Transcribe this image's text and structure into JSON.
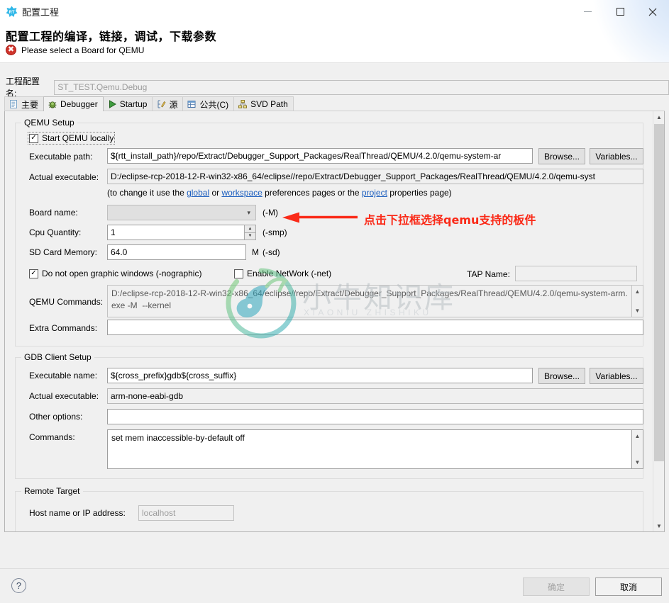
{
  "window": {
    "title": "配置工程",
    "app_icon": "rt-thread-icon",
    "minimize": "minimize-icon",
    "maximize": "maximize-icon",
    "close": "close-icon"
  },
  "header": {
    "title": "配置工程的编译，链接，调试，下载参数",
    "status_icon": "error-icon",
    "status_message": "Please select a Board for QEMU",
    "error_color": "#d0342c"
  },
  "config_name": {
    "label": "工程配置名:",
    "value": "ST_TEST.Qemu.Debug"
  },
  "tabs": [
    {
      "label": "主要",
      "icon": "document-icon",
      "active": false
    },
    {
      "label": "Debugger",
      "icon": "bug-icon",
      "active": true
    },
    {
      "label": "Startup",
      "icon": "play-icon",
      "active": false
    },
    {
      "label": "源",
      "icon": "source-icon",
      "active": false
    },
    {
      "label": "公共(C)",
      "icon": "table-icon",
      "active": false
    },
    {
      "label": "SVD Path",
      "icon": "tree-icon",
      "active": false
    }
  ],
  "qemu_setup": {
    "group_title": "QEMU Setup",
    "start_locally": {
      "label": "Start QEMU locally",
      "checked": true
    },
    "executable_path": {
      "label": "Executable path:",
      "value": "${rtt_install_path}/repo/Extract/Debugger_Support_Packages/RealThread/QEMU/4.2.0/qemu-system-ar",
      "browse": "Browse...",
      "variables": "Variables..."
    },
    "actual_executable": {
      "label": "Actual executable:",
      "value": "D:/eclipse-rcp-2018-12-R-win32-x86_64/eclipse//repo/Extract/Debugger_Support_Packages/RealThread/QEMU/4.2.0/qemu-syst"
    },
    "hint": {
      "prefix": "(to change it use the ",
      "link1": "global",
      "mid1": " or ",
      "link2": "workspace",
      "mid2": " preferences pages or the ",
      "link3": "project",
      "suffix": " properties page)"
    },
    "board_name": {
      "label": "Board name:",
      "value": "",
      "suffix": "(-M)"
    },
    "cpu_quantity": {
      "label": "Cpu Quantity:",
      "value": "1",
      "suffix": "(-smp)"
    },
    "sd_card_memory": {
      "label": "SD Card Memory:",
      "value": "64.0",
      "unit": "M",
      "suffix": "(-sd)"
    },
    "nographic": {
      "label": "Do not open graphic windows (-nographic)",
      "checked": true
    },
    "enable_network": {
      "label": "Enable NetWork (-net)",
      "checked": false
    },
    "tap_name": {
      "label": "TAP Name:",
      "value": ""
    },
    "qemu_commands": {
      "label": "QEMU Commands:",
      "value": "D:/eclipse-rcp-2018-12-R-win32-x86_64/eclipse//repo/Extract/Debugger_Support_Packages/RealThread/QEMU/4.2.0/qemu-system-arm.exe -M  --kernel"
    },
    "extra_commands": {
      "label": "Extra Commands:",
      "value": ""
    }
  },
  "gdb_client_setup": {
    "group_title": "GDB Client Setup",
    "executable_name": {
      "label": "Executable name:",
      "value": "${cross_prefix}gdb${cross_suffix}",
      "browse": "Browse...",
      "variables": "Variables..."
    },
    "actual_executable": {
      "label": "Actual executable:",
      "value": "arm-none-eabi-gdb"
    },
    "other_options": {
      "label": "Other options:",
      "value": ""
    },
    "commands": {
      "label": "Commands:",
      "value": "set mem inaccessible-by-default off"
    }
  },
  "remote_target": {
    "group_title": "Remote Target",
    "host_name": {
      "label": "Host name or IP address:",
      "value": "localhost"
    }
  },
  "annotation": {
    "text": "点击下拉框选择qemu支持的板件",
    "color": "#fa2a18"
  },
  "watermark": {
    "text": "小牛知识库",
    "subtext": "XIAONIU ZHISHIKU"
  },
  "footer": {
    "help": "?",
    "ok": "确定",
    "cancel": "取消"
  }
}
